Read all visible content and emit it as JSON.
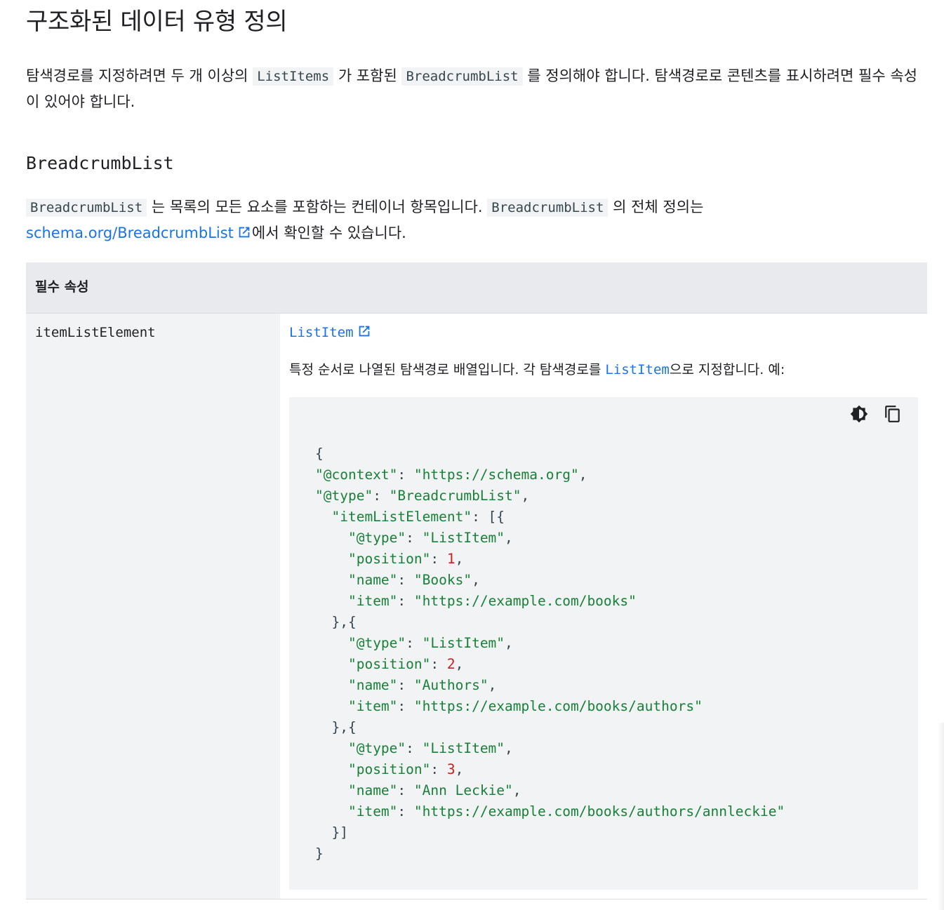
{
  "page": {
    "title": "구조화된 데이터 유형 정의",
    "intro": {
      "part1": "탐색경로를 지정하려면 두 개 이상의 ",
      "code1": "ListItems",
      "part2": " 가 포함된 ",
      "code2": "BreadcrumbList",
      "part3": " 를 정의해야 합니다. 탐색경로로 콘텐츠를 표시하려면 필수 속성이 있어야 합니다."
    },
    "section_heading": "BreadcrumbList",
    "section_desc": {
      "code1": "BreadcrumbList",
      "part1": " 는 목록의 모든 요소를 포함하는 컨테이너 항목입니다. ",
      "code2": "BreadcrumbList",
      "part2": " 의 전체 정의는",
      "link_text": "schema.org/BreadcrumbList",
      "part3": "에서 확인할 수 있습니다."
    },
    "colors": {
      "link": "#1a73e8",
      "string": "#188038",
      "number": "#c5221f",
      "table_header": "#e8eaed",
      "cell_bg": "#f1f3f4"
    }
  },
  "table": {
    "header": "필수 속성",
    "property_name": "itemListElement",
    "type_link": "ListItem",
    "description": {
      "part1": "특정 순서로 나열된 탐색경로 배열입니다. 각 탐색경로를 ",
      "code": "ListItem",
      "part2": "으로 지정합니다. 예:"
    },
    "code_tools": {
      "theme_icon": "dark-mode-toggle-icon",
      "copy_icon": "copy-icon"
    },
    "code_lines": [
      "{",
      "\"@context\": \"https://schema.org\",",
      "\"@type\": \"BreadcrumbList\",",
      "  \"itemListElement\": [{",
      "    \"@type\": \"ListItem\",",
      "    \"position\": 1,",
      "    \"name\": \"Books\",",
      "    \"item\": \"https://example.com/books\"",
      "  },{",
      "    \"@type\": \"ListItem\",",
      "    \"position\": 2,",
      "    \"name\": \"Authors\",",
      "    \"item\": \"https://example.com/books/authors\"",
      "  },{",
      "    \"@type\": \"ListItem\",",
      "    \"position\": 3,",
      "    \"name\": \"Ann Leckie\",",
      "    \"item\": \"https://example.com/books/authors/annleckie\"",
      "  }]",
      "}"
    ]
  }
}
